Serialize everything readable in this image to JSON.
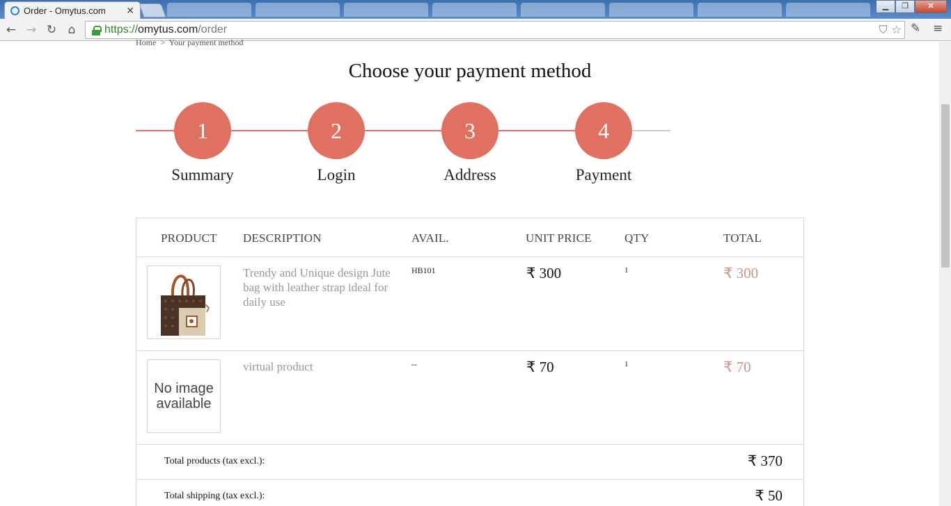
{
  "browser": {
    "tab_title": "Order - Omytus.com",
    "tab_close": "✕",
    "url_scheme": "https://",
    "url_host": "omytus.com",
    "url_path": "/order",
    "window_controls": [
      "▁",
      "❐",
      "✕"
    ]
  },
  "breadcrumb": {
    "home": "Home",
    "separator": ">",
    "current": "Your payment method"
  },
  "page_title": "Choose your payment method",
  "steps": [
    {
      "number": "1",
      "label": "Summary"
    },
    {
      "number": "2",
      "label": "Login"
    },
    {
      "number": "3",
      "label": "Address"
    },
    {
      "number": "4",
      "label": "Payment"
    }
  ],
  "colors": {
    "accent": "#e07062",
    "line_inactive": "#cccccc",
    "total_text": "#c9968a"
  },
  "cart": {
    "headers": [
      "PRODUCT",
      "DESCRIPTION",
      "AVAIL.",
      "UNIT PRICE",
      "QTY",
      "TOTAL"
    ],
    "rows": [
      {
        "image": "jute-bag-image",
        "description": "Trendy and Unique design Jute bag with leather strap ideal for daily use",
        "avail": "HB101",
        "unit_price": "₹ 300",
        "qty": "1",
        "total": "₹ 300"
      },
      {
        "image_text_1": "No image",
        "image_text_2": "available",
        "description": "virtual product",
        "avail": "--",
        "unit_price": "₹ 70",
        "qty": "1",
        "total": "₹ 70"
      }
    ],
    "summary": [
      {
        "label": "Total products (tax excl.):",
        "value": "₹ 370"
      },
      {
        "label": "Total shipping (tax excl.):",
        "value": "₹ 50"
      }
    ]
  }
}
